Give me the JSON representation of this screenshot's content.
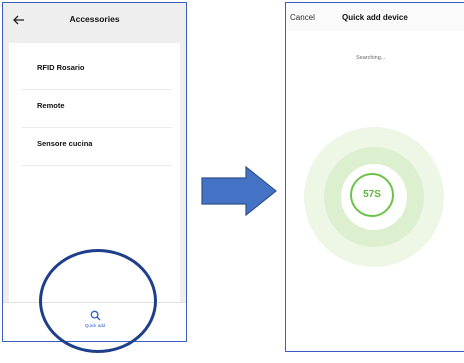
{
  "left_screen": {
    "header": {
      "title": "Accessories",
      "back_icon": "arrow-left-icon"
    },
    "items": [
      {
        "label": "RFID Rosario"
      },
      {
        "label": "Remote"
      },
      {
        "label": "Sensore cucina"
      }
    ],
    "bottom_bar": {
      "quick_add_label": "Quick add",
      "quick_add_icon": "search-icon"
    },
    "highlight_color": "#1f3f8a"
  },
  "arrow": {
    "icon": "right-arrow-icon",
    "color": "#4472c4"
  },
  "right_screen": {
    "header": {
      "cancel_label": "Cancel",
      "title": "Quick add device"
    },
    "status": "Searching...",
    "timer": "57S",
    "accent_color": "#6cc24a"
  },
  "colors": {
    "frame_border": "#3b5fc0"
  }
}
